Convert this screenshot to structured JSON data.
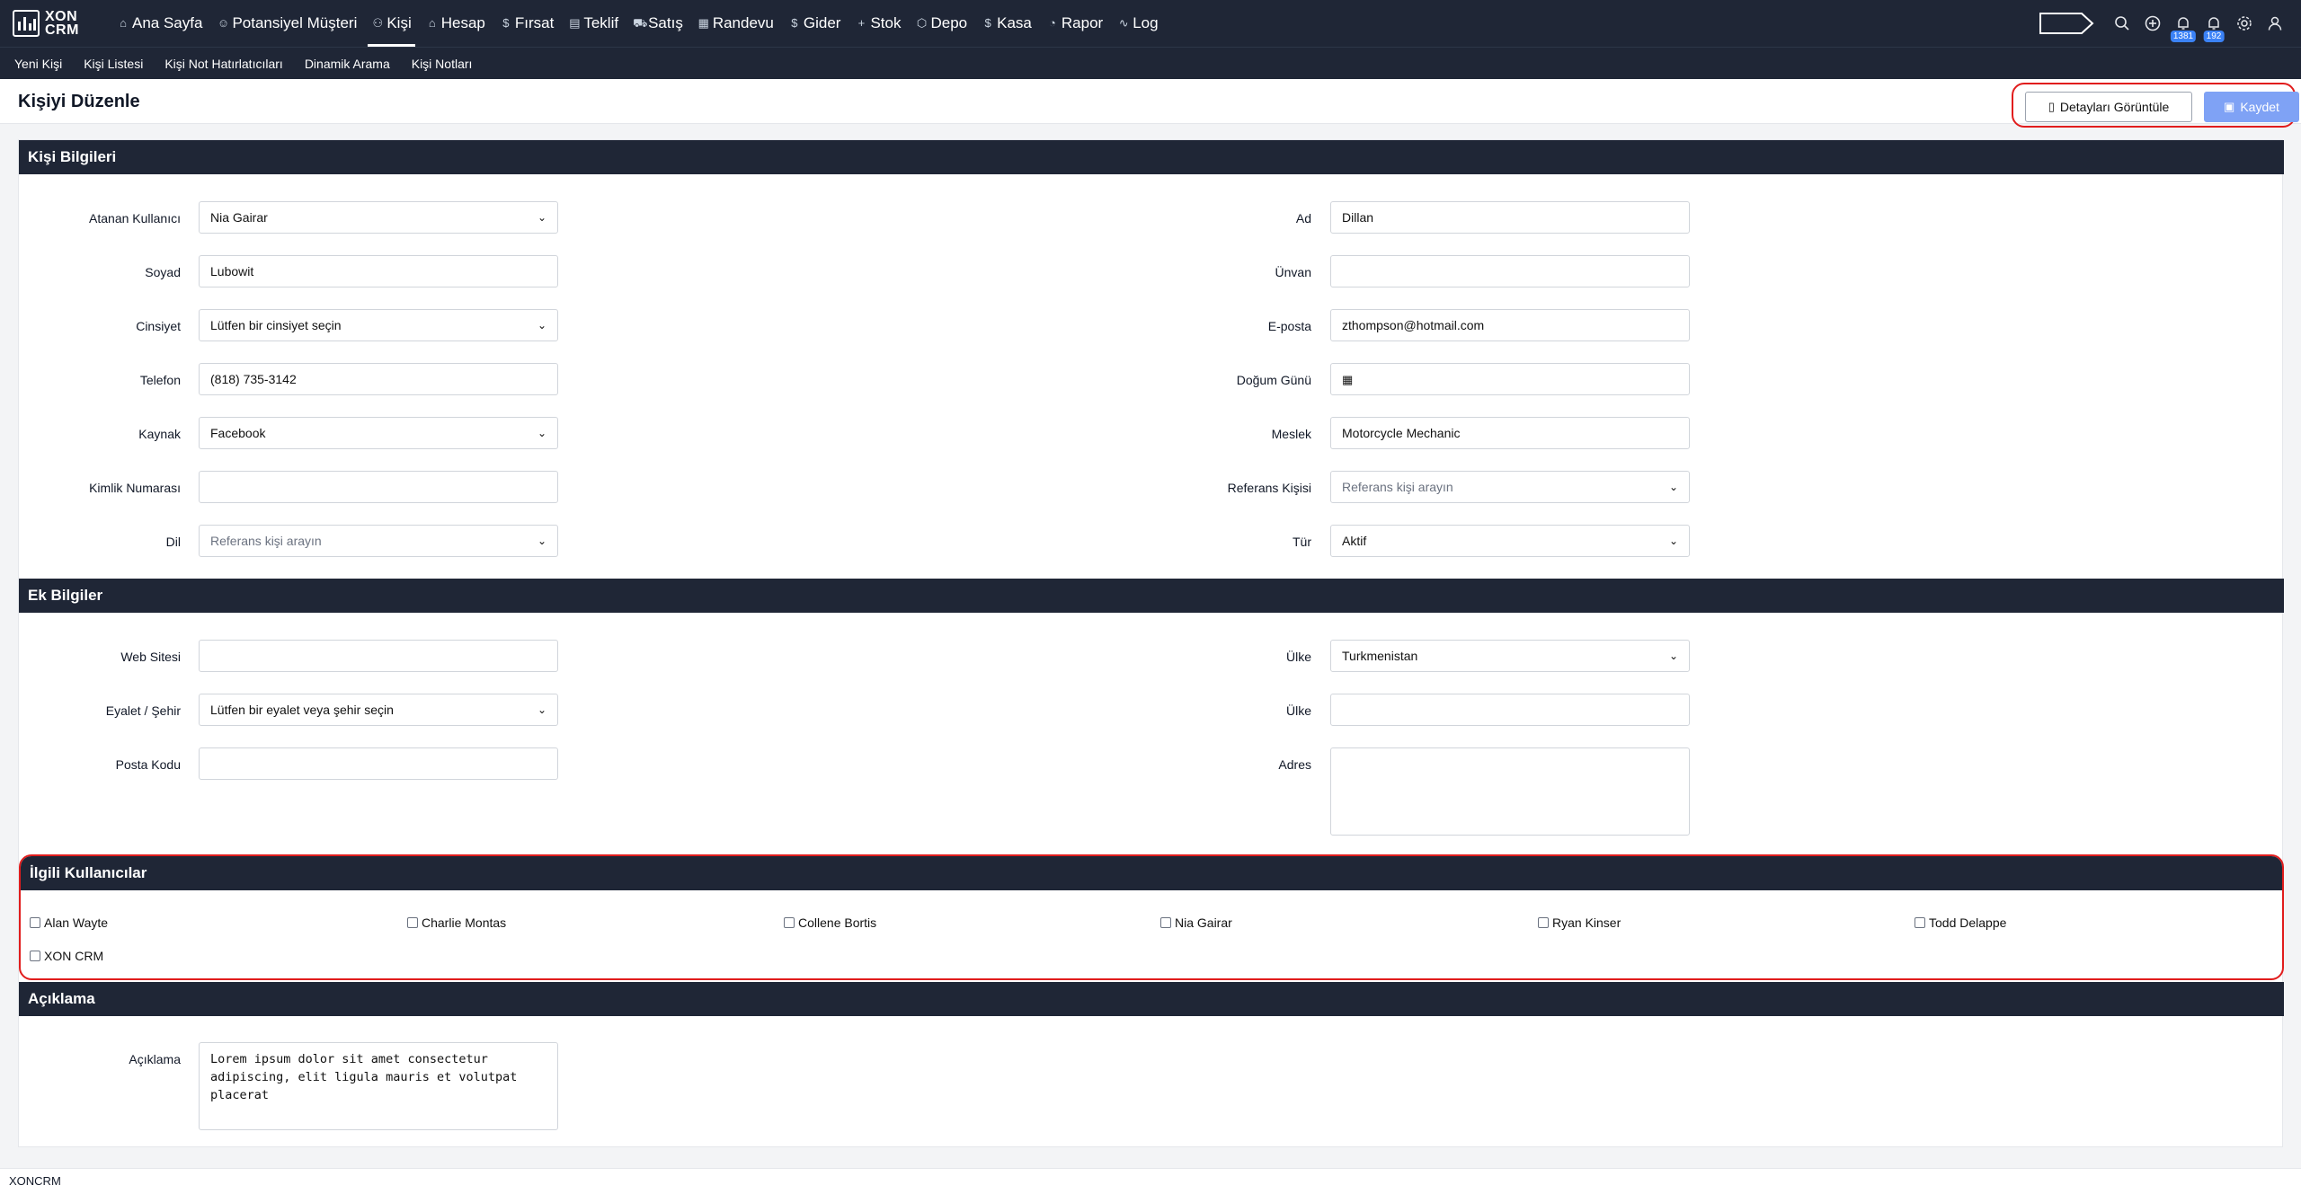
{
  "logo": {
    "line1": "XON",
    "line2": "CRM"
  },
  "nav": [
    {
      "label": "Ana Sayfa",
      "icon": "⌂"
    },
    {
      "label": "Potansiyel Müşteri",
      "icon": "☺"
    },
    {
      "label": "Kişi",
      "icon": "⚇"
    },
    {
      "label": "Hesap",
      "icon": "⌂"
    },
    {
      "label": "Fırsat",
      "icon": "$"
    },
    {
      "label": "Teklif",
      "icon": "▤"
    },
    {
      "label": "Satış",
      "icon": "⛟"
    },
    {
      "label": "Randevu",
      "icon": "▦"
    },
    {
      "label": "Gider",
      "icon": "$"
    },
    {
      "label": "Stok",
      "icon": "+"
    },
    {
      "label": "Depo",
      "icon": "⬡"
    },
    {
      "label": "Kasa",
      "icon": "$"
    },
    {
      "label": "Rapor",
      "icon": "◔"
    },
    {
      "label": "Log",
      "icon": "∿"
    }
  ],
  "badges": {
    "notifications": "1381",
    "alerts": "192"
  },
  "subnav": [
    "Yeni Kişi",
    "Kişi Listesi",
    "Kişi Not Hatırlatıcıları",
    "Dinamik Arama",
    "Kişi Notları"
  ],
  "page": {
    "title": "Kişiyi Düzenle",
    "details_label": "Detayları Görüntüle",
    "save_label": "Kaydet"
  },
  "sections": {
    "kisi": "Kişi Bilgileri",
    "ek": "Ek Bilgiler",
    "ilgili": "İlgili Kullanıcılar",
    "aciklama": "Açıklama"
  },
  "kisi": {
    "assigned_label": "Atanan Kullanıcı",
    "assigned_value": "Nia Gairar",
    "ad_label": "Ad",
    "ad_value": "Dillan",
    "soyad_label": "Soyad",
    "soyad_value": "Lubowit",
    "unvan_label": "Ünvan",
    "unvan_value": "",
    "cinsiyet_label": "Cinsiyet",
    "cinsiyet_value": "Lütfen bir cinsiyet seçin",
    "eposta_label": "E-posta",
    "eposta_value": "zthompson@hotmail.com",
    "telefon_label": "Telefon",
    "telefon_value": "(818) 735-3142",
    "dogum_label": "Doğum Günü",
    "dogum_value": "",
    "kaynak_label": "Kaynak",
    "kaynak_value": "Facebook",
    "meslek_label": "Meslek",
    "meslek_value": "Motorcycle Mechanic",
    "kimlik_label": "Kimlik Numarası",
    "kimlik_value": "",
    "referans_label": "Referans Kişisi",
    "referans_value": "Referans kişi arayın",
    "dil_label": "Dil",
    "dil_value": "Referans kişi arayın",
    "tur_label": "Tür",
    "tur_value": "Aktif"
  },
  "ek": {
    "web_label": "Web Sitesi",
    "web_value": "",
    "ulke1_label": "Ülke",
    "ulke1_value": "Turkmenistan",
    "eyalet_label": "Eyalet / Şehir",
    "eyalet_value": "Lütfen bir eyalet veya şehir seçin",
    "ulke2_label": "Ülke",
    "ulke2_value": "",
    "posta_label": "Posta Kodu",
    "posta_value": "",
    "adres_label": "Adres",
    "adres_value": ""
  },
  "users": [
    "Alan Wayte",
    "Charlie Montas",
    "Collene Bortis",
    "Nia Gairar",
    "Ryan Kinser",
    "Todd Delappe",
    "XON CRM"
  ],
  "aciklama": {
    "label": "Açıklama",
    "lines": [
      "Lorem ipsum dolor sit amet consectetur",
      "adipiscing, elit ligula mauris et volutpat",
      "placerat"
    ]
  },
  "footer": "XONCRM"
}
